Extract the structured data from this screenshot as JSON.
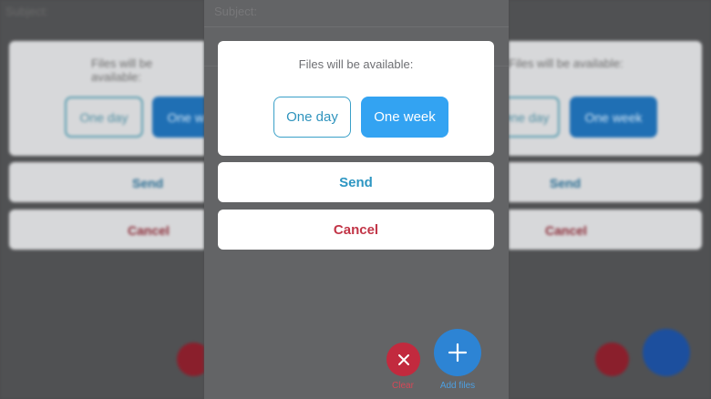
{
  "compose": {
    "subject_label": "Subject:"
  },
  "dialog": {
    "availability_label": "Files will be available:",
    "options": [
      {
        "label": "One day",
        "selected": false
      },
      {
        "label": "One week",
        "selected": true
      }
    ],
    "send_label": "Send",
    "cancel_label": "Cancel"
  },
  "actions": {
    "clear_label": "Clear",
    "add_files_label": "Add files",
    "clear_icon": "close-icon",
    "add_icon": "plus-icon"
  },
  "colors": {
    "accent_blue": "#33a3f2",
    "send_blue": "#2d96c2",
    "cancel_red": "#c23547",
    "clear_red": "#c22a3e"
  }
}
